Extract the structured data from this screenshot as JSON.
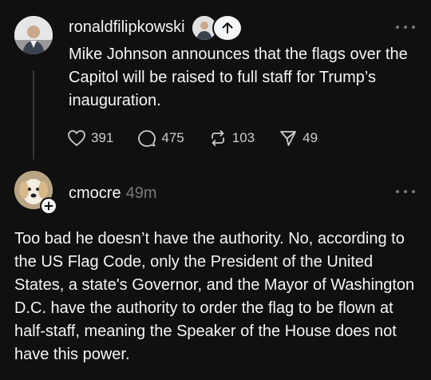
{
  "post1": {
    "username": "ronaldfilipkowski",
    "text": "Mike Johnson announces that the flags over the Capitol will be raised to full staff for Trump’s inauguration.",
    "likes": "391",
    "replies": "475",
    "reposts": "103",
    "shares": "49"
  },
  "post2": {
    "username": "cmocre",
    "time": "49m",
    "text": "Too bad he doesn’t have the authority. No, according to the US Flag Code, only the President of the United States, a state's Governor, and the Mayor of Washington D.C. have the authority to order the flag to be flown at half-staff, meaning the Speaker of the House does not have this power."
  },
  "icons": {
    "like": "heart-icon",
    "reply": "comment-icon",
    "repost": "repost-icon",
    "share": "send-icon",
    "more": "more-icon",
    "follow": "plus-icon",
    "scroll_top": "arrow-up-icon"
  }
}
